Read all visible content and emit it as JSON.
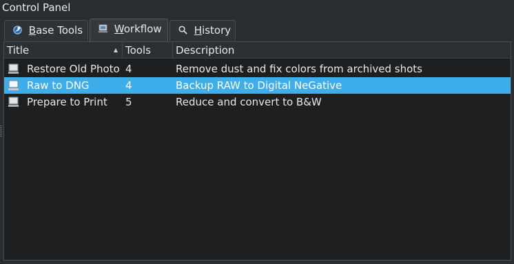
{
  "window": {
    "title": "Control Panel"
  },
  "tabs": [
    {
      "label_pre": "",
      "label_ul": "B",
      "label_post": "ase Tools",
      "icon": "base-tools-icon",
      "active": false
    },
    {
      "label_pre": "",
      "label_ul": "W",
      "label_post": "orkflow",
      "icon": "workflow-icon",
      "active": true
    },
    {
      "label_pre": "",
      "label_ul": "H",
      "label_post": "istory",
      "icon": "search-icon",
      "active": false
    }
  ],
  "table": {
    "columns": [
      "Title",
      "Tools",
      "Description"
    ],
    "sort_column": "Title",
    "sort_order": "ascending",
    "rows": [
      {
        "title": "Restore Old Photo",
        "tools": "4",
        "description": "Remove dust and fix colors from archived shots",
        "selected": false
      },
      {
        "title": "Raw to DNG",
        "tools": "4",
        "description": "Backup RAW to Digital NeGative",
        "selected": true
      },
      {
        "title": "Prepare to Print",
        "tools": "5",
        "description": "Reduce and convert to B&W",
        "selected": false
      }
    ]
  },
  "colors": {
    "selection": "#3daee9",
    "background": "#1e1f21",
    "window": "#2a2d30"
  }
}
